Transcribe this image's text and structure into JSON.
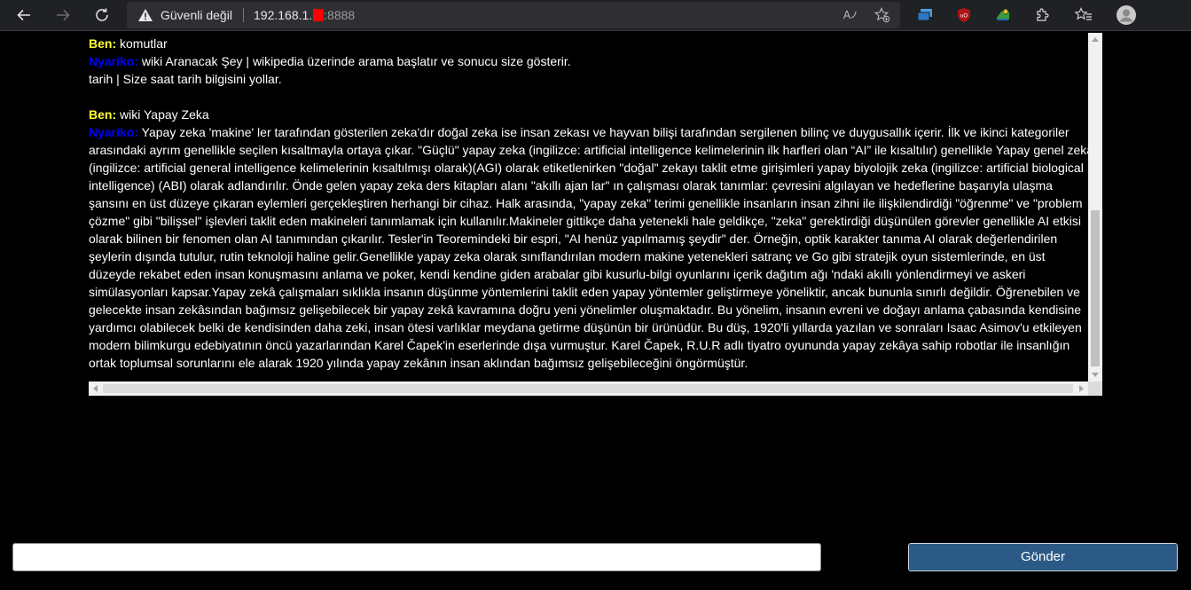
{
  "browser": {
    "security_text": "Güvenli değil",
    "url_host": "192.168.1.",
    "url_port": ":8888",
    "read_aloud_label": "A",
    "icons": [
      "back-icon",
      "forward-icon",
      "refresh-icon",
      "warning-icon",
      "read-aloud-icon",
      "add-favorite-icon",
      "collections-icon",
      "ublock-icon",
      "extension-green-icon",
      "extensions-icon",
      "favorites-icon",
      "profile-icon"
    ]
  },
  "chat": {
    "messages": [
      {
        "speaker": "Ben:",
        "text": " komutlar"
      },
      {
        "speaker": "Nyariko:",
        "text": " wiki Aranacak Şey | wikipedia üzerinde arama başlatır ve sonucu size gösterir."
      },
      {
        "text": "tarih | Size saat tarih bilgisini yollar."
      },
      {
        "speaker": "Ben:",
        "text": " wiki Yapay Zeka"
      },
      {
        "speaker": "Nyariko:",
        "text": " Yapay zeka 'makine' ler tarafından gösterilen zeka'dır doğal zeka ise insan zekası ve hayvan bilişi tarafından sergilenen bilinç ve duygusallık içerir. İlk ve ikinci kategoriler arasındaki ayrım genellikle seçilen kısaltmayla ortaya çıkar. \"Güçlü\" yapay zeka (ingilizce: artificial intelligence kelimelerinin ilk harfleri olan “AI” ile kısaltılır) genellikle Yapay genel zekâ (ingilizce: artificial general intelligence kelimelerinin kısaltılmışı olarak)(AGI) olarak etiketlenirken \"doğal\" zekayı taklit etme girişimleri yapay biyolojik zeka (ingilizce: artificial biological intelligence) (ABI) olarak adlandırılır. Önde gelen yapay zeka ders kitapları alanı \"akıllı ajan lar\" ın çalışması olarak tanımlar: çevresini algılayan ve hedeflerine başarıyla ulaşma şansını en üst düzeye çıkaran eylemleri gerçekleştiren herhangi bir cihaz. Halk arasında, \"yapay zeka\" terimi genellikle insanların insan zihni ile ilişkilendirdiği \"öğrenme\" ve \"problem çözme\" gibi \"bilişsel\" işlevleri taklit eden makineleri tanımlamak için kullanılır.Makineler gittikçe daha yetenekli hale geldikçe, \"zeka\" gerektirdiği düşünülen görevler genellikle AI etkisi olarak bilinen bir fenomen olan AI tanımından çıkarılır. Tesler'in Teoremindeki bir espri, \"AI henüz yapılmamış şeydir\" der. Örneğin, optik karakter tanıma AI olarak değerlendirilen şeylerin dışında tutulur, rutin teknoloji haline gelir.Genellikle yapay zeka olarak sınıflandırılan modern makine yetenekleri satranç ve Go gibi stratejik oyun sistemlerinde, en üst düzeyde rekabet eden insan konuşmasını anlama ve poker, kendi kendine giden arabalar gibi kusurlu-bilgi oyunlarını içerik dağıtım ağı 'ndaki akıllı yönlendirmeyi ve askeri simülasyonları kapsar.Yapay zekâ çalışmaları sıklıkla insanın düşünme yöntemlerini taklit eden yapay yöntemler geliştirmeye yöneliktir, ancak bununla sınırlı değildir. Öğrenebilen ve gelecekte insan zekâsından bağımsız gelişebilecek bir yapay zekâ kavramına doğru yeni yönelimler oluşmaktadır. Bu yönelim, insanın evreni ve doğayı anlama çabasında kendisine yardımcı olabilecek belki de kendisinden daha zeki, insan ötesi varlıklar meydana getirme düşünün bir ürünüdür. Bu düş, 1920'li yıllarda yazılan ve sonraları Isaac Asimov'u etkileyen modern bilimkurgu edebiyatının öncü yazarlarından Karel Čapek'in eserlerinde dışa vurmuştur. Karel Čapek, R.U.R adlı tiyatro oyununda yapay zekâya sahip robotlar ile insanlığın ortak toplumsal sorunlarını ele alarak 1920 yılında yapay zekânın insan aklından bağımsız gelişebileceğini öngörmüştür."
      }
    ]
  },
  "input": {
    "value": "",
    "placeholder": ""
  },
  "send_button": {
    "label": "Gönder"
  },
  "colors": {
    "user_speaker": "#ffff33",
    "bot_speaker": "#0000ff",
    "send_button_bg": "#2c5a86",
    "page_bg": "#000000"
  }
}
